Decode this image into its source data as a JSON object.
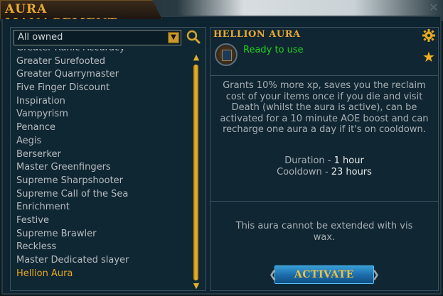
{
  "window": {
    "title": "AURA MANAGEMENT"
  },
  "filter": {
    "selected": "All owned"
  },
  "aura_list": [
    "Greater Runic Accuracy",
    "Greater Surefooted",
    "Greater Quarrymaster",
    "Five Finger Discount",
    "Inspiration",
    "Vampyrism",
    "Penance",
    "Aegis",
    "Berserker",
    "Master Greenfingers",
    "Supreme Sharpshooter",
    "Supreme Call of the Sea",
    "Enrichment",
    "Festive",
    "Supreme Brawler",
    "Reckless",
    "Master Dedicated slayer",
    "Hellion Aura"
  ],
  "selected_aura_index": 17,
  "details": {
    "name": "HELLION AURA",
    "status": "Ready to use",
    "description": "Grants 10% more xp, saves you the reclaim cost of your items once if you die and visit Death (whilst the aura is active), can be activated for a 10 minute AOE boost and can recharge one aura a day if it's on cooldown.",
    "duration_label": "Duration - ",
    "duration_value": "1 hour",
    "cooldown_label": "Cooldown - ",
    "cooldown_value": "23 hours",
    "extend_note": "This aura cannot be extended with vis wax.",
    "activate_label": "ACTIVATE"
  },
  "colors": {
    "accent": "#e8a832",
    "status_ready": "#20d020",
    "selected_item": "#e8a822"
  },
  "icons": {
    "settings": "gear-icon",
    "favourite": "star-icon",
    "search": "search-icon"
  }
}
